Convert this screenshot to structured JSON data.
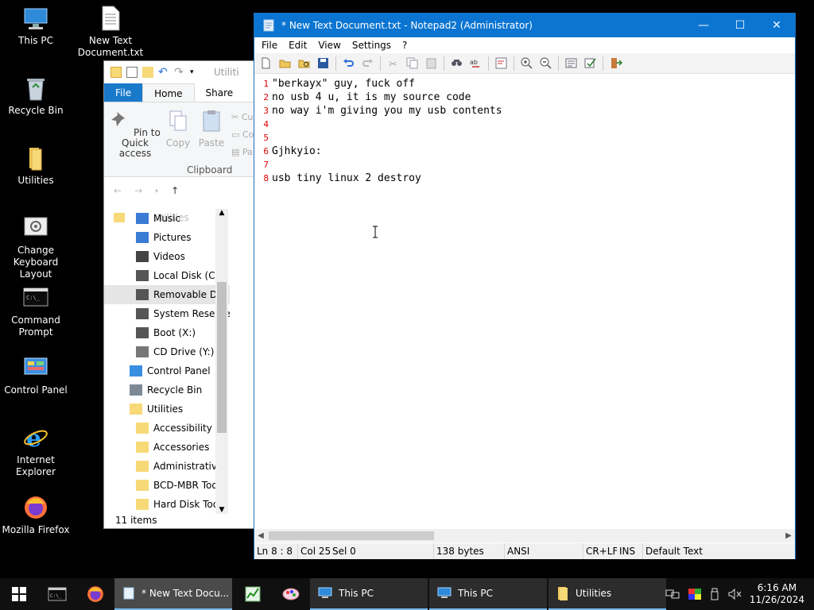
{
  "desktop": {
    "icons": [
      {
        "label": "This PC",
        "icon": "computer-icon"
      },
      {
        "label": "New Text Document.txt",
        "icon": "text-file-icon"
      },
      {
        "label": "Recycle Bin",
        "icon": "recycle-bin-icon"
      },
      {
        "label": "Utilities",
        "icon": "folder-icon"
      },
      {
        "label": "Change Keyboard Layout",
        "icon": "keyboard-settings-icon"
      },
      {
        "label": "Command Prompt",
        "icon": "console-icon"
      },
      {
        "label": "Control Panel",
        "icon": "control-panel-icon"
      },
      {
        "label": "Internet Explorer",
        "icon": "ie-icon"
      },
      {
        "label": "Mozilla Firefox",
        "icon": "firefox-icon"
      }
    ]
  },
  "explorer": {
    "address_partial": "Utiliti",
    "tabs": {
      "file": "File",
      "home": "Home",
      "share": "Share"
    },
    "ribbon": {
      "pin_label": "Pin to Quick access",
      "copy_label": "Copy",
      "paste_label": "Paste",
      "cut_partial": "Cu",
      "copypath_partial": "Co",
      "pasteshortcut_partial": "Pa",
      "group_label": "Clipboard"
    },
    "address_crumb": "Utilities",
    "nav_items": [
      {
        "label": "Music",
        "indent": 1
      },
      {
        "label": "Pictures",
        "indent": 1
      },
      {
        "label": "Videos",
        "indent": 1
      },
      {
        "label": "Local Disk (C:)",
        "indent": 1
      },
      {
        "label": "Removable Dis",
        "indent": 1,
        "selected": true
      },
      {
        "label": "System Reserve",
        "indent": 1
      },
      {
        "label": "Boot (X:)",
        "indent": 1
      },
      {
        "label": "CD Drive (Y:) H",
        "indent": 1
      },
      {
        "label": "Control Panel",
        "indent": 0
      },
      {
        "label": "Recycle Bin",
        "indent": 0
      },
      {
        "label": "Utilities",
        "indent": 0
      },
      {
        "label": "Accessibility",
        "indent": 1
      },
      {
        "label": "Accessories",
        "indent": 1
      },
      {
        "label": "Administrative",
        "indent": 1
      },
      {
        "label": "BCD-MBR Tool",
        "indent": 1
      },
      {
        "label": "Hard Disk Tool:",
        "indent": 1
      }
    ],
    "status": "11 items"
  },
  "notepad": {
    "title": "* New Text Document.txt - Notepad2 (Administrator)",
    "menu": [
      "File",
      "Edit",
      "View",
      "Settings",
      "?"
    ],
    "lines": [
      {
        "num": "1",
        "text": "\"berkayx\" guy, fuck off"
      },
      {
        "num": "2",
        "text": "no usb 4 u, it is my source code"
      },
      {
        "num": "3",
        "text": "no way i'm giving you my usb contents"
      },
      {
        "num": "4",
        "text": ""
      },
      {
        "num": "5",
        "text": ""
      },
      {
        "num": "6",
        "text": "Gjhkyio:"
      },
      {
        "num": "7",
        "text": ""
      },
      {
        "num": "8",
        "text": "usb tiny linux 2 destroy"
      }
    ],
    "status": {
      "position": "Ln 8 : 8",
      "column": "Col 25",
      "selection": "Sel 0",
      "size": "138 bytes",
      "encoding": "ANSI",
      "eol": "CR+LF",
      "mode": "INS",
      "scheme": "Default Text"
    }
  },
  "taskbar": {
    "tasks": [
      {
        "label": "* New Text Docu...",
        "active": true
      },
      {
        "label": "This PC",
        "active": false
      },
      {
        "label": "This PC",
        "active": false
      },
      {
        "label": "Utilities",
        "active": false
      }
    ],
    "time": "6:16 AM",
    "date": "11/26/2024"
  },
  "colors": {
    "titlebar": "#0b75d1",
    "line_number": "#e00000",
    "ribbon_file": "#1979ca"
  }
}
